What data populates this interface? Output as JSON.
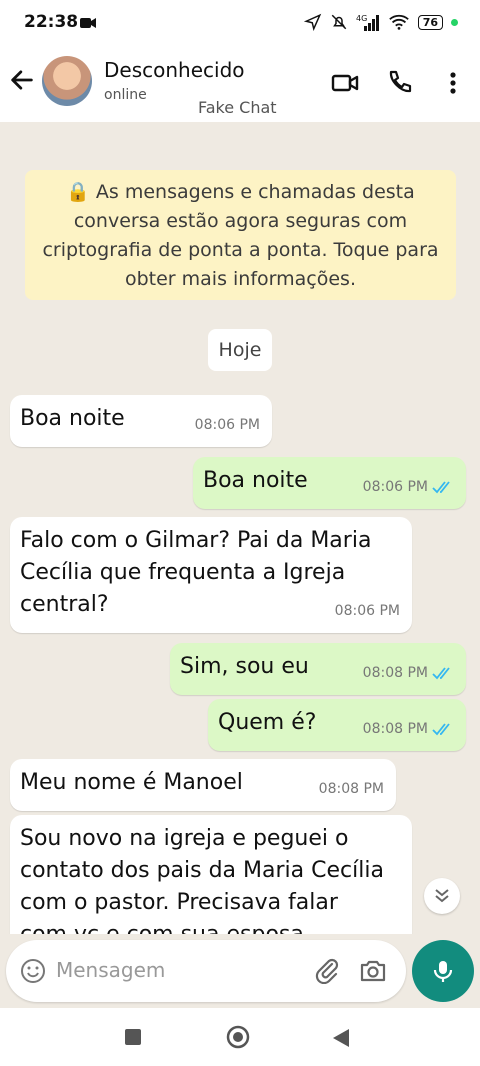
{
  "status_bar": {
    "time": "22:38",
    "battery": "76"
  },
  "header": {
    "contact_name": "Desconhecido",
    "presence": "online",
    "overlay_caption": "Fake Chat"
  },
  "chat": {
    "encryption_notice": "🔒 As mensagens e chamadas desta conversa estão agora seguras com criptografia de ponta a ponta. Toque para obter mais informações.",
    "date_chip": "Hoje",
    "messages": [
      {
        "direction": "in",
        "text": "Boa noite",
        "time": "08:06 PM"
      },
      {
        "direction": "out",
        "text": "Boa noite",
        "time": "08:06 PM",
        "ticks": "read"
      },
      {
        "direction": "in",
        "text": "Falo com o Gilmar? Pai da Maria Cecília que frequenta a Igreja central?",
        "time": "08:06 PM"
      },
      {
        "direction": "out",
        "text": "Sim, sou eu",
        "time": "08:08 PM",
        "ticks": "read"
      },
      {
        "direction": "out",
        "text": "Quem é?",
        "time": "08:08 PM",
        "ticks": "read"
      },
      {
        "direction": "in",
        "text": "Meu nome é Manoel",
        "time": "08:08 PM"
      },
      {
        "direction": "in",
        "text": "Sou novo na igreja e peguei o contato dos pais da Maria Cecília com o pastor. Precisava falar com vc e com sua esposa",
        "time": ""
      }
    ]
  },
  "composer": {
    "placeholder": "Mensagem"
  },
  "colors": {
    "outgoing_bubble": "#dcf8c6",
    "incoming_bubble": "#ffffff",
    "accent": "#128c7e",
    "tick_blue": "#34b7f1"
  }
}
